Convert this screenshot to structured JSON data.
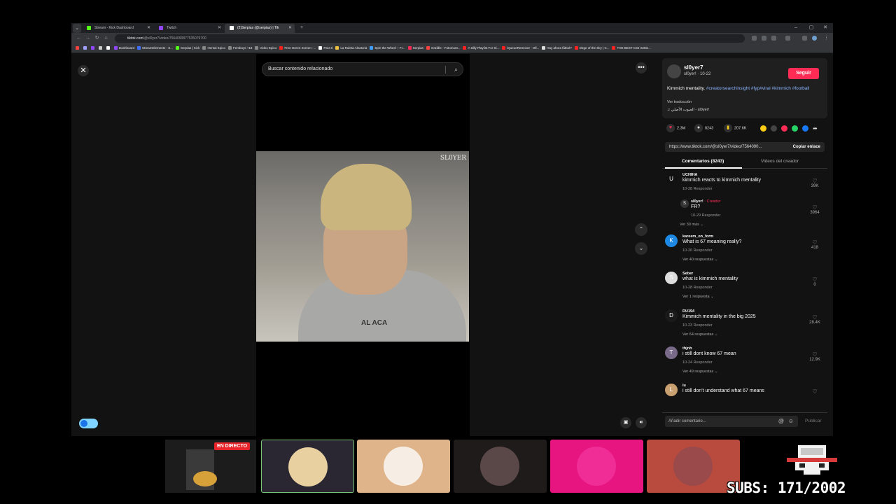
{
  "browser": {
    "tabs": [
      {
        "label": "Stream - Kick Dashboard",
        "color": "#53fc18",
        "active": false
      },
      {
        "label": "Twitch",
        "color": "#9146ff",
        "active": false
      },
      {
        "label": "(2)Serpias (@serpias) | Tik",
        "color": "#ffffff",
        "active": true
      }
    ],
    "new_tab": "+",
    "window_controls": {
      "minimize": "–",
      "maximize": "▢",
      "close": "✕"
    },
    "url_host": "tiktok.com",
    "url_path": "/@sl0yer7/video/7564090877535079700",
    "bookmarks": [
      {
        "label": "",
        "color": "#ff4040"
      },
      {
        "label": "",
        "color": "#a0a0ff"
      },
      {
        "label": "",
        "color": "#9146ff"
      },
      {
        "label": "",
        "color": "#cccccc"
      },
      {
        "label": "",
        "color": "#ffffff"
      },
      {
        "label": "Dashboard",
        "color": "#9146ff"
      },
      {
        "label": "StreamElements - S...",
        "color": "#4070ff"
      },
      {
        "label": "Serpias | Kick",
        "color": "#53fc18"
      },
      {
        "label": "Hentai Epico",
        "color": "#888888"
      },
      {
        "label": "Femboys +18",
        "color": "#888888"
      },
      {
        "label": "Video Epico",
        "color": "#888888"
      },
      {
        "label": "Free Green Screen -...",
        "color": "#ff2020"
      },
      {
        "label": "Para ti",
        "color": "#ffffff"
      },
      {
        "label": "La Ruleta Aleatoria",
        "color": "#f0c040"
      },
      {
        "label": "Spin the Wheel – Fr...",
        "color": "#40a0ff"
      },
      {
        "label": "Serpias",
        "color": "#fe2c55"
      },
      {
        "label": "Grafdle - Fotomont...",
        "color": "#ff4040"
      },
      {
        "label": "A Silly Playlist For Si...",
        "color": "#ff2020"
      },
      {
        "label": "iQueueRemover - Oll...",
        "color": "#ff2020"
      },
      {
        "label": "Hay ahora fútbol?",
        "color": "#dddddd"
      },
      {
        "label": "Dirge of the Sky | C...",
        "color": "#ff2020"
      },
      {
        "label": "THE BEST CS2 Settin...",
        "color": "#ff2020"
      }
    ]
  },
  "tiktok": {
    "search_placeholder": "Buscar contenido relacionado",
    "watermark": "SL0YER",
    "shirt_text": "AL ACA",
    "author": "sl0yer7",
    "author_sub": "sl0yer! · 10-22",
    "follow": "Seguir",
    "description_prefix": "Kimmich mentality. ",
    "description_tags": "#creatorsearchinsight #fyp#viral #kimmich #football",
    "translate": "Ver traducción",
    "music": "♫ الصوت الأصلي - sl0yer!",
    "likes": "2.3M",
    "comments_count": "8243",
    "saves": "207.6K",
    "link": "https://www.tiktok.com/@sl0yer7/video/7564090...",
    "copy_link": "Copiar enlace",
    "tab_comments": "Comentarios (8243)",
    "tab_creator": "Videos del creador",
    "comments": [
      {
        "user": "UCHIHA",
        "text": "kimmich reacts to kimmich mentality",
        "meta": "10-28    Responder",
        "likes": "39K",
        "more": "",
        "avatar": "U",
        "color": "#111111"
      },
      {
        "user": "sl0yer!",
        "creator_tag": " · Creador",
        "text": "FR?",
        "meta": "10-29    Responder",
        "likes": "3964",
        "more": "Ver 30 más ⌄",
        "avatar": "S",
        "color": "#333333"
      },
      {
        "user": "kareem_on_form",
        "text": "What is 67 meaning really?",
        "meta": "10-26    Responder",
        "likes": "418",
        "more": "Ver 40 respuestas ⌄",
        "avatar": "K",
        "color": "#1e88e5"
      },
      {
        "user": "Seber",
        "text": "what is kimmich mentality",
        "meta": "10-28    Responder",
        "likes": "0",
        "more": "Ver 1 respuesta ⌄",
        "avatar": "S",
        "color": "#dddddd"
      },
      {
        "user": "DU194",
        "text": "Kimmich mentality in the big 2025",
        "meta": "10-23    Responder",
        "likes": "28.4K",
        "more": "Ver 64 respuestas ⌄",
        "avatar": "D",
        "color": "#1a1a1a"
      },
      {
        "user": "thjnh",
        "text": "i still dont know 67 mean",
        "meta": "10-24    Responder",
        "likes": "12.9K",
        "more": "Ver 49 respuestas ⌄",
        "avatar": "T",
        "color": "#7a6a8a"
      },
      {
        "user": "lu",
        "text": "i still don't understand what 67 means",
        "meta": "",
        "likes": "",
        "more": "",
        "avatar": "L",
        "color": "#c9a070"
      }
    ],
    "comment_placeholder": "Añadir comentario...",
    "publish": "Publicar"
  },
  "stream": {
    "live_badge": "EN DIRECTO",
    "subs": "SUBS: 171/2002",
    "thumb_colors": [
      "#2a2632",
      "#e0b48a",
      "#1f1b1b",
      "#e6157f",
      "#b84b3e"
    ]
  }
}
